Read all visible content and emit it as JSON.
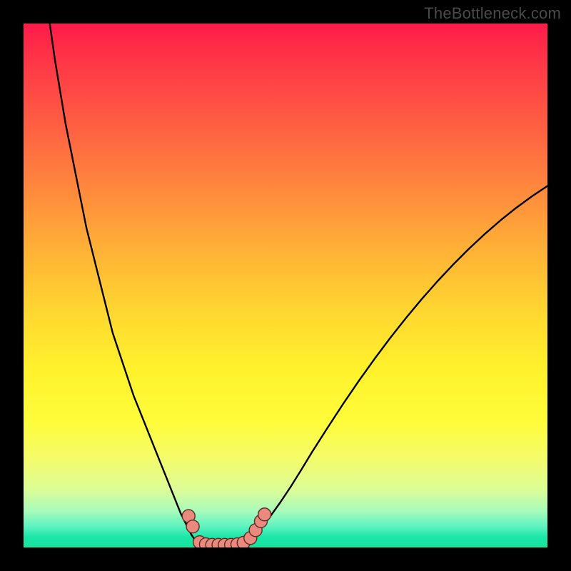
{
  "attribution": "TheBottleneck.com",
  "chart_data": {
    "type": "line",
    "title": "",
    "xlabel": "",
    "ylabel": "",
    "xlim": [
      0,
      100
    ],
    "ylim": [
      0,
      100
    ],
    "gradient_stops": [
      {
        "pos": 0,
        "color": "#ff1b4a"
      },
      {
        "pos": 6,
        "color": "#ff3247"
      },
      {
        "pos": 18,
        "color": "#ff5a43"
      },
      {
        "pos": 30,
        "color": "#ff833e"
      },
      {
        "pos": 42,
        "color": "#ffad37"
      },
      {
        "pos": 54,
        "color": "#ffd430"
      },
      {
        "pos": 66,
        "color": "#fff22c"
      },
      {
        "pos": 76,
        "color": "#fffc3a"
      },
      {
        "pos": 83,
        "color": "#f4fc6a"
      },
      {
        "pos": 89,
        "color": "#dcfd97"
      },
      {
        "pos": 93,
        "color": "#a9fbba"
      },
      {
        "pos": 96,
        "color": "#5df3c0"
      },
      {
        "pos": 98,
        "color": "#1be6a8"
      },
      {
        "pos": 100,
        "color": "#15e49c"
      }
    ],
    "series": [
      {
        "name": "left-branch",
        "x": [
          5,
          6,
          7,
          8,
          9,
          10,
          11,
          12,
          13,
          14,
          15,
          16,
          17,
          18,
          19,
          20,
          21,
          22,
          23,
          24,
          25,
          26,
          27,
          28,
          29,
          30,
          31,
          32,
          33
        ],
        "y": [
          100,
          93,
          87,
          81,
          76,
          71,
          66,
          61,
          57,
          53,
          49,
          45,
          41,
          38,
          35,
          32,
          29,
          26.5,
          24,
          21.5,
          19,
          16.5,
          14,
          11.5,
          9,
          6.5,
          4.5,
          2.5,
          1
        ]
      },
      {
        "name": "valley-floor",
        "x": [
          33,
          34,
          35,
          36,
          37,
          38,
          39,
          40,
          41,
          42,
          43
        ],
        "y": [
          1,
          0.4,
          0.15,
          0.05,
          0,
          0,
          0,
          0.05,
          0.2,
          0.5,
          1.0
        ]
      },
      {
        "name": "right-branch",
        "x": [
          43,
          45,
          47,
          49,
          51,
          53,
          55,
          58,
          61,
          64,
          67,
          70,
          73,
          76,
          79,
          82,
          85,
          88,
          91,
          94,
          97,
          100
        ],
        "y": [
          1.0,
          3.2,
          5.8,
          8.6,
          11.6,
          14.8,
          18.1,
          22.8,
          27.4,
          31.8,
          36.0,
          40.0,
          43.8,
          47.4,
          50.8,
          54.0,
          57.0,
          59.8,
          62.4,
          64.8,
          67.0,
          69.0
        ]
      }
    ],
    "markers": [
      {
        "x": 31.5,
        "y": 6.0
      },
      {
        "x": 32.3,
        "y": 4.0
      },
      {
        "x": 33.6,
        "y": 1.0
      },
      {
        "x": 34.8,
        "y": 0.6
      },
      {
        "x": 36.0,
        "y": 0.5
      },
      {
        "x": 37.2,
        "y": 0.5
      },
      {
        "x": 38.4,
        "y": 0.5
      },
      {
        "x": 39.6,
        "y": 0.5
      },
      {
        "x": 40.8,
        "y": 0.6
      },
      {
        "x": 42.0,
        "y": 0.9
      },
      {
        "x": 43.3,
        "y": 1.8
      },
      {
        "x": 44.3,
        "y": 3.3
      },
      {
        "x": 45.3,
        "y": 5.0
      },
      {
        "x": 46.0,
        "y": 6.3
      }
    ],
    "marker_style": {
      "radius_px": 9,
      "fill": "#ea8a7f",
      "stroke": "#5c2a24",
      "stroke_width": 1.4
    }
  }
}
